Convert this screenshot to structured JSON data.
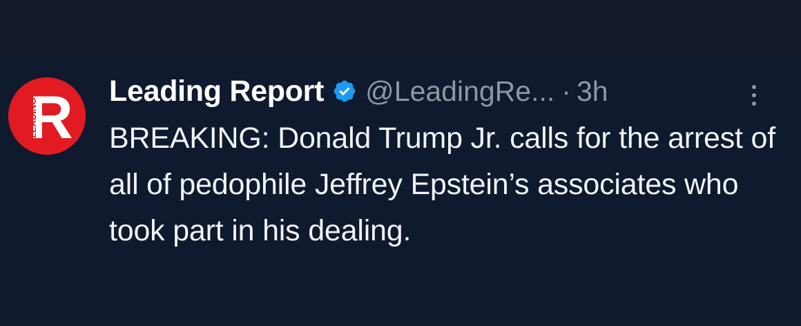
{
  "tweet": {
    "display_name": "Leading Report",
    "handle": "@LeadingRe...",
    "separator": "·",
    "time": "3h",
    "text": "BREAKING: Donald Trump Jr. calls for the arrest of all of pedophile Jeffrey Epstein’s associates who took part in his dealing.",
    "avatar_letter": "R",
    "avatar_word": "LEADING",
    "verified_icon": "verified-badge-icon",
    "more_icon": "more-vertical-icon"
  },
  "colors": {
    "background": "#0f1a2e",
    "top_bar": "#121a29",
    "name": "#ffffff",
    "secondary": "#8b98a5",
    "verified": "#1d9bf0",
    "avatar": "#e21b23"
  }
}
